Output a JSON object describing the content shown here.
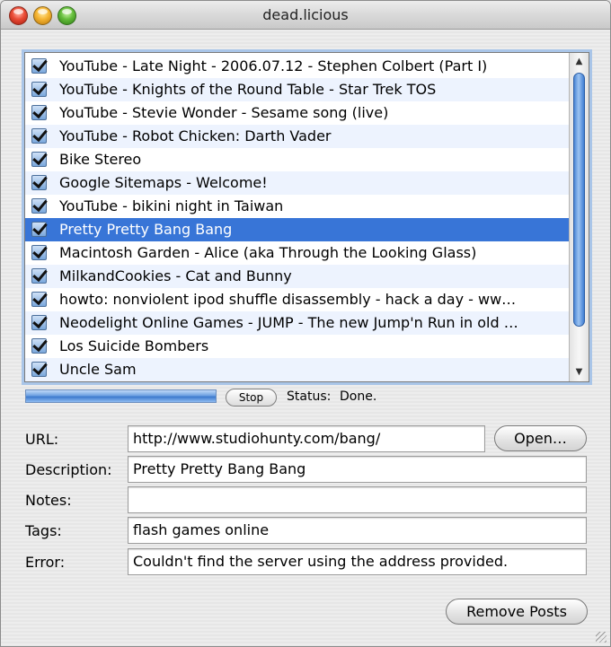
{
  "window": {
    "title": "dead.licious"
  },
  "posts": [
    {
      "label": "YouTube - Late Night - 2006.07.12 - Stephen Colbert (Part I)",
      "checked": true
    },
    {
      "label": "YouTube - Knights of the Round Table - Star Trek TOS",
      "checked": true
    },
    {
      "label": "YouTube - Stevie Wonder - Sesame song (live)",
      "checked": true
    },
    {
      "label": "YouTube - Robot Chicken: Darth Vader",
      "checked": true
    },
    {
      "label": "Bike Stereo",
      "checked": true
    },
    {
      "label": "Google Sitemaps - Welcome!",
      "checked": true
    },
    {
      "label": "YouTube - bikini night in Taiwan",
      "checked": true
    },
    {
      "label": "Pretty Pretty Bang Bang",
      "checked": true,
      "selected": true
    },
    {
      "label": "Macintosh Garden - Alice (aka Through the Looking Glass)",
      "checked": true
    },
    {
      "label": "MilkandCookies - Cat and Bunny",
      "checked": true
    },
    {
      "label": "howto: nonviolent ipod shuffle disassembly - hack a day - ww…",
      "checked": true
    },
    {
      "label": "Neodelight Online Games - JUMP - The new Jump'n Run in old …",
      "checked": true
    },
    {
      "label": "Los Suicide Bombers",
      "checked": true
    },
    {
      "label": "Uncle Sam",
      "checked": true
    }
  ],
  "progress": {
    "value": 1.0
  },
  "stop_label": "Stop",
  "status": {
    "label": "Status:",
    "value": "Done."
  },
  "fields": {
    "url": {
      "label": "URL:",
      "value": "http://www.studiohunty.com/bang/"
    },
    "description": {
      "label": "Description:",
      "value": "Pretty Pretty Bang Bang"
    },
    "notes": {
      "label": "Notes:",
      "value": ""
    },
    "tags": {
      "label": "Tags:",
      "value": "flash games online"
    },
    "error": {
      "label": "Error:",
      "value": "Couldn't find the server using the address provided."
    }
  },
  "open_label": "Open…",
  "remove_label": "Remove Posts",
  "icons": {
    "close": "close-icon",
    "minimize": "minimize-icon",
    "zoom": "zoom-icon",
    "scroll_up": "arrow-up-icon",
    "scroll_down": "arrow-down-icon",
    "checkbox": "checkbox-checked-icon",
    "resize": "resize-grip-icon"
  },
  "colors": {
    "selection": "#3875d7",
    "alt_row": "#edf3fe",
    "aqua_blue": "#3f7ed4"
  }
}
